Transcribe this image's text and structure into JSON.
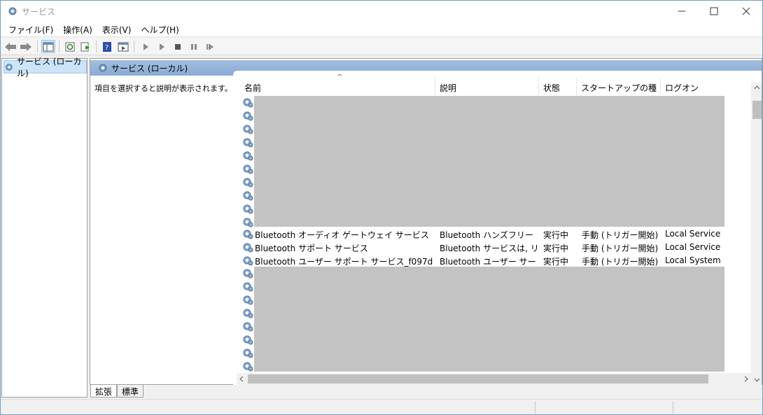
{
  "window": {
    "title": "サービス",
    "icon": "gear-icon"
  },
  "menu": [
    "ファイル(F)",
    "操作(A)",
    "表示(V)",
    "ヘルプ(H)"
  ],
  "tree": {
    "root_label": "サービス (ローカル)"
  },
  "panel": {
    "header_title": "サービス (ローカル)",
    "description_hint": "項目を選択すると説明が表示されます。"
  },
  "table": {
    "columns": [
      "名前",
      "説明",
      "状態",
      "スタートアップの種類",
      "ログオン"
    ],
    "rows": [
      {
        "name": "Bluetooth オーディオ ゲートウェイ サービス",
        "description": "Bluetooth ハンズフリー プロ…",
        "status": "実行中",
        "startup": "手動 (トリガー開始)",
        "logon": "Local Service"
      },
      {
        "name": "Bluetooth サポート サービス",
        "description": "Bluetooth サービスは, リモ…",
        "status": "実行中",
        "startup": "手動 (トリガー開始)",
        "logon": "Local Service"
      },
      {
        "name": "Bluetooth ユーザー サポート サービス_f097d",
        "description": "Bluetooth ユーザー サービ…",
        "status": "実行中",
        "startup": "手動 (トリガー開始)",
        "logon": "Local System"
      }
    ]
  },
  "tabs": [
    "拡張",
    "標準"
  ],
  "colors": {
    "header_bg": "#8fb1d8",
    "redacted": "#c3c3c3",
    "selection": "#cce4f7"
  }
}
